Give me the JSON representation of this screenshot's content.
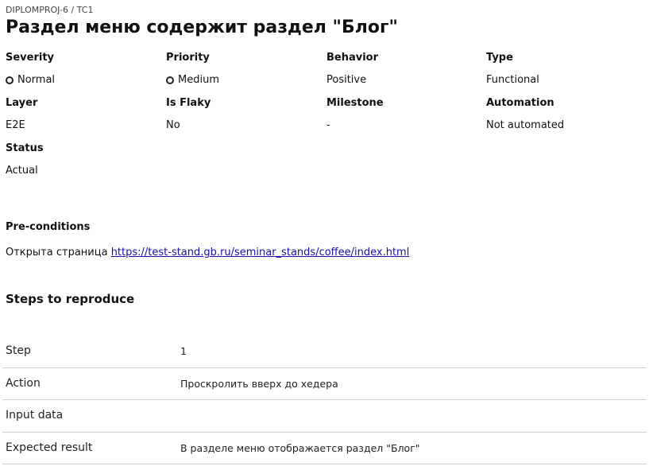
{
  "breadcrumb": "DIPLOMPROJ-6 / TC1",
  "title": "Раздел меню содержит раздел \"Блог\"",
  "fields": {
    "severity": {
      "label": "Severity",
      "value": "Normal"
    },
    "priority": {
      "label": "Priority",
      "value": "Medium"
    },
    "behavior": {
      "label": "Behavior",
      "value": "Positive"
    },
    "type": {
      "label": "Type",
      "value": "Functional"
    },
    "layer": {
      "label": "Layer",
      "value": "E2E"
    },
    "is_flaky": {
      "label": "Is Flaky",
      "value": "No"
    },
    "milestone": {
      "label": "Milestone",
      "value": "-"
    },
    "automation": {
      "label": "Automation",
      "value": "Not automated"
    },
    "status": {
      "label": "Status",
      "value": "Actual"
    }
  },
  "preconditions": {
    "label": "Pre-conditions",
    "text": "Открыта страница ",
    "link": "https://test-stand.gb.ru/seminar_stands/coffee/index.html"
  },
  "steps": {
    "title": "Steps to reproduce",
    "rows": [
      {
        "key": "Step",
        "value": "1"
      },
      {
        "key": "Action",
        "value": "Проскролить вверх до хедера"
      },
      {
        "key": "Input data",
        "value": ""
      },
      {
        "key": "Expected result",
        "value": "В разделе меню отображается раздел \"Блог\""
      }
    ]
  }
}
